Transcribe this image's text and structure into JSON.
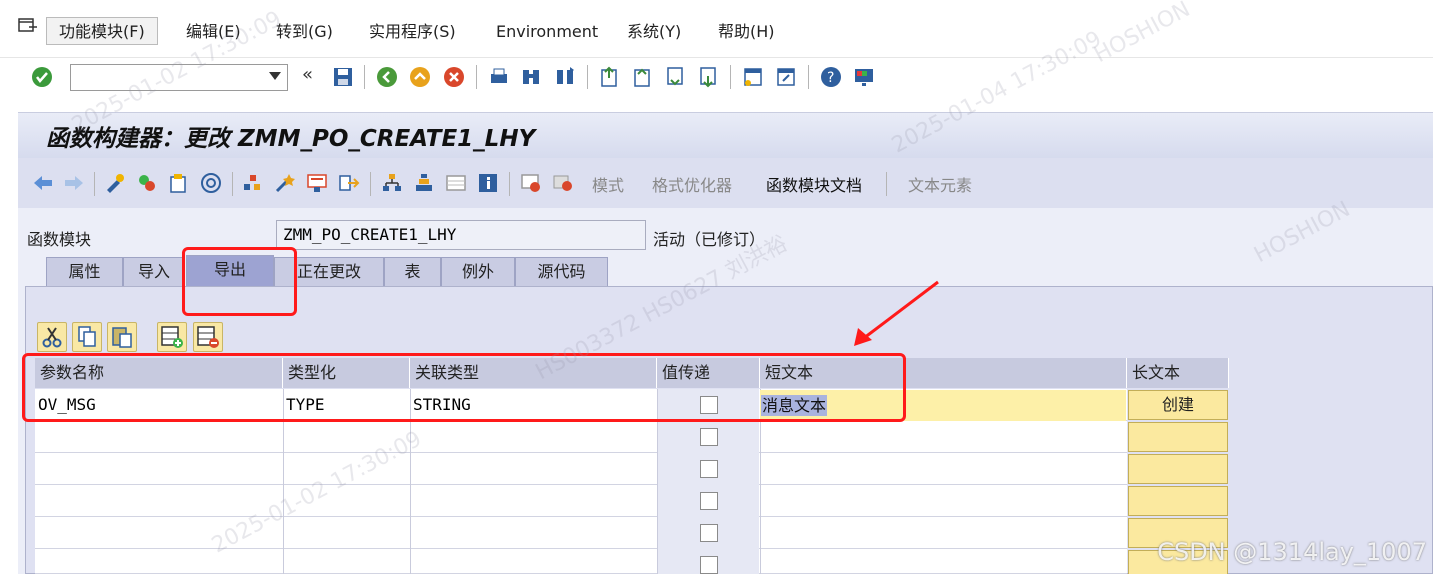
{
  "menu": {
    "items": [
      {
        "label": "功能模块(F)"
      },
      {
        "label": "编辑(E)"
      },
      {
        "label": "转到(G)"
      },
      {
        "label": "实用程序(S)"
      },
      {
        "label": "Environment"
      },
      {
        "label": "系统(Y)"
      },
      {
        "label": "帮助(H)"
      }
    ]
  },
  "command_field": {
    "value": ""
  },
  "title": "函数构建器：更改 ZMM_PO_CREATE1_LHY",
  "app_toolbar": {
    "mode_label": "模式",
    "pretty_printer_label": "格式优化器",
    "fm_doc_label": "函数模块文档",
    "text_elements_label": "文本元素"
  },
  "function_module": {
    "label": "函数模块",
    "value": "ZMM_PO_CREATE1_LHY",
    "status": "活动（已修订）"
  },
  "tabs": [
    {
      "label": "属性"
    },
    {
      "label": "导入"
    },
    {
      "label": "导出"
    },
    {
      "label": "正在更改"
    },
    {
      "label": "表"
    },
    {
      "label": "例外"
    },
    {
      "label": "源代码"
    }
  ],
  "table": {
    "headers": {
      "param_name": "参数名称",
      "typing": "类型化",
      "assoc_type": "关联类型",
      "pass_value": "值传递",
      "short_text": "短文本",
      "long_text": "长文本"
    },
    "rows": [
      {
        "param_name": "OV_MSG",
        "typing": "TYPE",
        "assoc_type": "STRING",
        "short_text": "消息文本",
        "long_text_button": "创建"
      }
    ]
  },
  "watermarks": {
    "w1": "2025-01-02 17:30:09",
    "w2": "HOSHION",
    "w3": "2025-01-04 17:30:09",
    "w4": "HS003372 HS0627 刘洪裕",
    "footer": "CSDN @1314lay_1007"
  },
  "colors": {
    "title_bg": "#d6dbee",
    "content_bg": "#eceef8",
    "active_tab": "#9da3d2",
    "annotation_red": "#ff1a1a",
    "long_text_button": "#fbe99f"
  }
}
